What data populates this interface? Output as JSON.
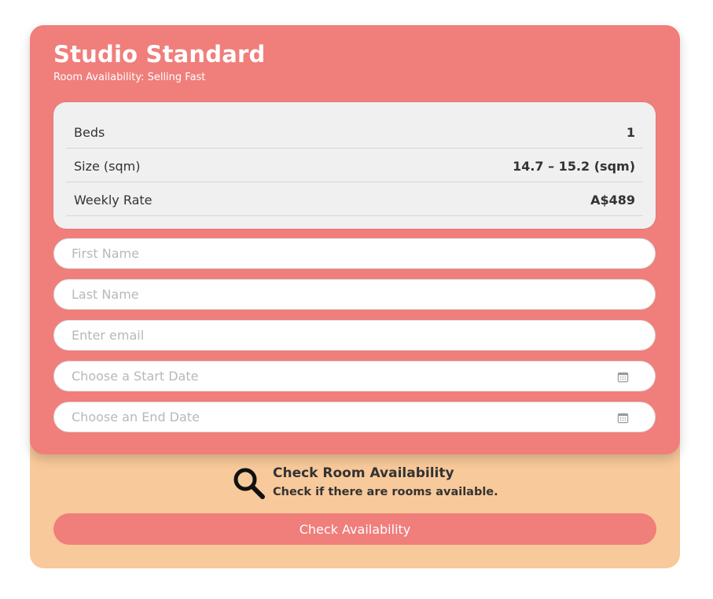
{
  "room": {
    "title": "Studio Standard",
    "availability": "Room Availability: Selling Fast"
  },
  "details": [
    {
      "label": "Beds",
      "value": "1"
    },
    {
      "label": "Size (sqm)",
      "value": "14.7 – 15.2 (sqm)"
    },
    {
      "label": "Weekly Rate",
      "value": "A$489"
    }
  ],
  "form": {
    "first_name_placeholder": "First Name",
    "last_name_placeholder": "Last Name",
    "email_placeholder": "Enter email",
    "start_date_placeholder": "Choose a Start Date",
    "end_date_placeholder": "Choose an End Date"
  },
  "check": {
    "title": "Check Room Availability",
    "subtitle": "Check if there are rooms available.",
    "button_label": "Check Availability"
  },
  "icons": {
    "calendar": "calendar-icon",
    "search": "search-icon"
  },
  "colors": {
    "card": "#f07e7b",
    "panel": "#f8c99a",
    "details_bg": "#f0f0f0",
    "text": "#333333"
  }
}
